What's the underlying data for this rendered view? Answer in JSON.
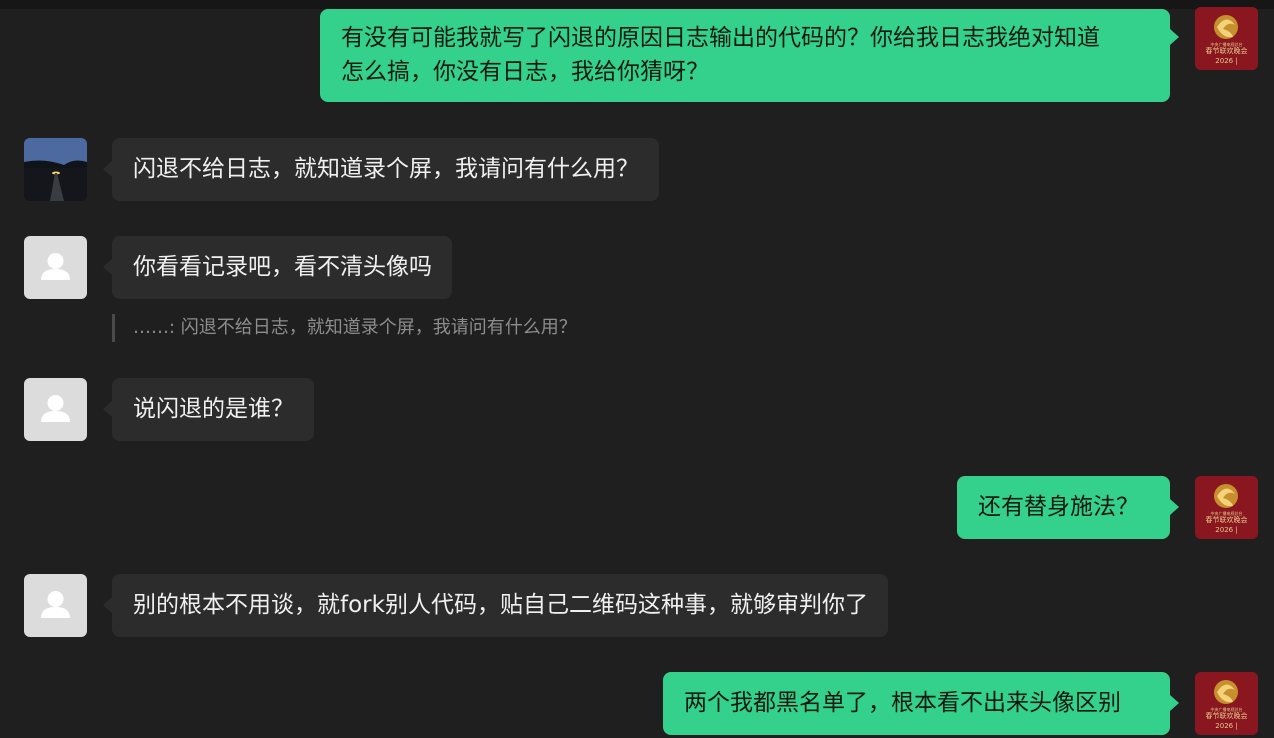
{
  "self_avatar": {
    "line1": "中央广播电视总台",
    "line2": "春节联欢晚会",
    "line3": "2026 |"
  },
  "messages": [
    {
      "id": "m1",
      "side": "me",
      "lines": [
        "有没有可能我就写了闪退的原因日志输出的代码的？你给我日志我绝对知道",
        "怎么搞，你没有日志，我给你猜呀？"
      ]
    },
    {
      "id": "m2",
      "side": "them",
      "avatar": "photo-avatar",
      "text": "闪退不给日志，就知道录个屏，我请问有什么用？"
    },
    {
      "id": "m3",
      "side": "them",
      "avatar": "grey-avatar",
      "text": "你看看记录吧，看不清头像吗"
    },
    {
      "id": "q1",
      "quote": "……: 闪退不给日志，就知道录个屏，我请问有什么用？"
    },
    {
      "id": "m4",
      "side": "them",
      "avatar": "grey-avatar",
      "text": "说闪退的是谁？"
    },
    {
      "id": "m5",
      "side": "me",
      "text": "还有替身施法？"
    },
    {
      "id": "m6",
      "side": "them",
      "avatar": "grey-avatar",
      "text": "别的根本不用谈，就fork别人代码，贴自己二维码这种事，就够审判你了"
    },
    {
      "id": "m7",
      "side": "me",
      "text": "两个我都黑名单了，根本看不出来头像区别"
    }
  ],
  "colors": {
    "background": "#1f1f1f",
    "my_bubble": "#34d18c",
    "their_bubble": "#2c2c2c",
    "quote_text": "#8d8d8d"
  }
}
